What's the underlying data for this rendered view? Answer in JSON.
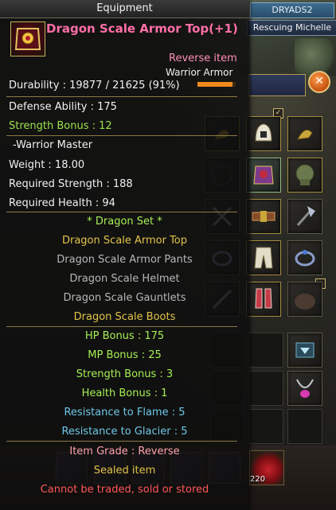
{
  "window": {
    "title": "Equipment"
  },
  "hud": {
    "target_name": "DRYADS2",
    "quest_label": "Rescuing Michelle",
    "close_glyph": "✕",
    "check_glyph": "✓",
    "potion_count": "220"
  },
  "item": {
    "name": "Dragon Scale Armor Top(+1)",
    "tag": "Reverse item",
    "type": "Warrior Armor",
    "durability": "Durability : 19877 / 21625 (91%)",
    "durability_fraction": 0.91,
    "stats": {
      "defense": "Defense Ability : 175",
      "strength_bonus": "Strength Bonus : 12",
      "class": "-Warrior Master",
      "weight": "Weight : 18.00",
      "req_strength": "Required Strength : 188",
      "req_health": "Required Health : 94"
    },
    "set": {
      "header": "* Dragon Set *",
      "pieces": [
        {
          "name": "Dragon Scale Armor Top",
          "equipped": true
        },
        {
          "name": "Dragon Scale Armor Pants",
          "equipped": false
        },
        {
          "name": "Dragon Scale Helmet",
          "equipped": false
        },
        {
          "name": "Dragon Scale Gauntlets",
          "equipped": false
        },
        {
          "name": "Dragon Scale Boots",
          "equipped": true
        }
      ],
      "bonuses": [
        {
          "text": "HP Bonus : 175",
          "kind": "stat"
        },
        {
          "text": "MP Bonus : 25",
          "kind": "stat"
        },
        {
          "text": "Strength Bonus : 3",
          "kind": "stat"
        },
        {
          "text": "Health Bonus : 1",
          "kind": "stat"
        },
        {
          "text": "Resistance to Flame : 5",
          "kind": "resist"
        },
        {
          "text": "Resistance to Glacier : 5",
          "kind": "resist"
        }
      ]
    },
    "grade": "Item Grade : Reverse",
    "sealed": "Sealed item",
    "restriction": "Cannot be traded, sold or stored"
  },
  "colors": {
    "item_name": "#ff6fa5",
    "equipped_piece": "#e3c449",
    "missing_piece": "#b7b7b7",
    "bonus": "#a6ee55",
    "resist": "#6fc8e8",
    "restriction": "#ff5656",
    "durability_bar": "#f08a1c"
  },
  "equipment_slots": [
    "earring-icon",
    "helmet-icon",
    "earring-icon",
    "empty-slot",
    "armor-top-icon",
    "pauldron-icon",
    "swords-icon",
    "belt-icon",
    "axe-icon",
    "ring-icon",
    "pants-icon",
    "ring-icon",
    "dagger-icon",
    "boots-icon",
    "bag-slot-icon"
  ],
  "bag_slots": [
    "crystal-icon",
    "necklace-icon"
  ]
}
